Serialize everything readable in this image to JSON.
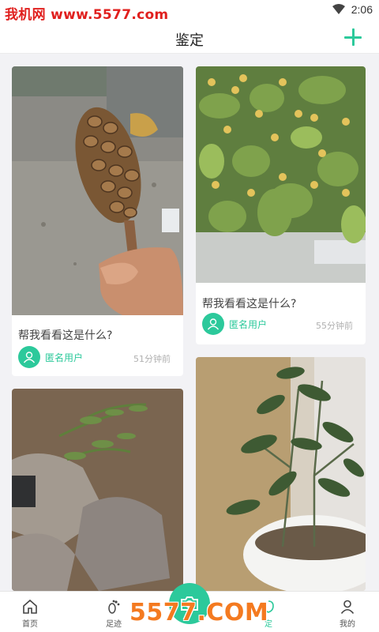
{
  "status_bar": {
    "watermark": "我机网 www.5577.com",
    "time": "2:06"
  },
  "header": {
    "title": "鉴定",
    "add_icon": "plus-icon",
    "accent": "#2cc99b"
  },
  "feed": [
    {
      "question": "帮我看看这是什么?",
      "user": "匿名用户",
      "time_ago": "51分钟前",
      "photo": "magnolia-seed-pod"
    },
    {
      "question": "帮我看看这是什么?",
      "user": "匿名用户",
      "time_ago": "55分钟前",
      "photo": "crabapple-tree"
    },
    {
      "question": "",
      "user": "",
      "time_ago": "",
      "photo": "weeds-on-rocks"
    },
    {
      "question": "",
      "user": "",
      "time_ago": "",
      "photo": "potted-shrub"
    }
  ],
  "tab_bar": {
    "tabs": [
      {
        "label": "首页",
        "icon": "home-icon"
      },
      {
        "label": "足迹",
        "icon": "footprint-icon"
      },
      {
        "label": "定",
        "icon": "identify-icon"
      },
      {
        "label": "我的",
        "icon": "user-icon"
      }
    ],
    "camera_icon": "camera-icon",
    "watermark": "5577.COM"
  }
}
